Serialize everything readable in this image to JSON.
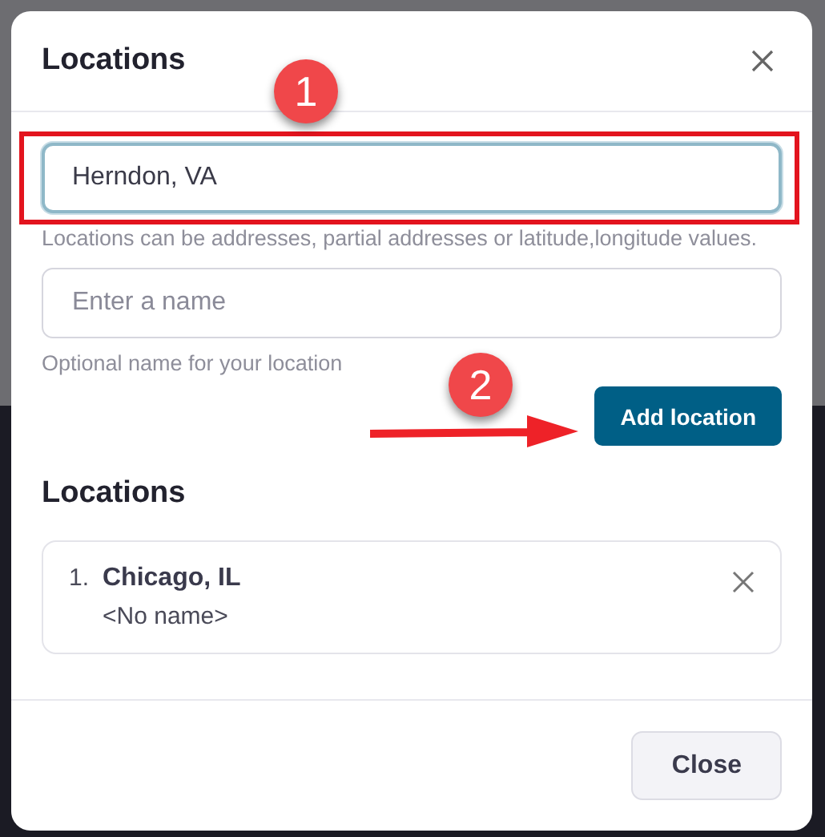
{
  "dialog": {
    "title": "Locations"
  },
  "location_field": {
    "value": "Herndon, VA",
    "focused": true,
    "help": "Locations can be addresses, partial addresses or latitude,longitude values."
  },
  "name_field": {
    "placeholder": "Enter a name",
    "help": "Optional name for your location"
  },
  "add_button": "Add location",
  "list_heading": "Locations",
  "locations": [
    {
      "number": "1.",
      "name": "Chicago, IL",
      "label": "<No name>"
    }
  ],
  "footer_buttons": [
    "Close"
  ],
  "annotations": [
    {
      "kind": "step",
      "text": "1"
    },
    {
      "kind": "step",
      "text": "2"
    },
    {
      "kind": "highlight"
    },
    {
      "kind": "arrow"
    }
  ]
}
